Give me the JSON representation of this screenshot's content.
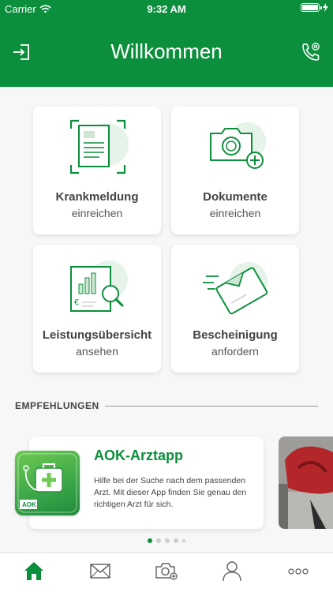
{
  "status_bar": {
    "carrier": "Carrier",
    "time": "9:32 AM"
  },
  "header": {
    "title": "Willkommen",
    "login_icon": "login-icon",
    "call_icon": "phone-email-icon"
  },
  "cards": [
    {
      "line1": "Krankmeldung",
      "line2": "einreichen",
      "icon": "document-scan-icon"
    },
    {
      "line1": "Dokumente",
      "line2": "einreichen",
      "icon": "camera-add-icon"
    },
    {
      "line1": "Leistungsübersicht",
      "line2": "ansehen",
      "icon": "report-search-icon"
    },
    {
      "line1": "Bescheinigung",
      "line2": "anfordern",
      "icon": "certificate-request-icon"
    }
  ],
  "recommendations": {
    "label": "EMPFEHLUNGEN",
    "items": [
      {
        "title": "AOK-Arztapp",
        "description": "Hilfe bei der Suche nach dem passenden Arzt. Mit dieser App finden Sie genau den richtigen Arzt für sich.",
        "icon_badge": "AOK"
      }
    ]
  },
  "tabs": [
    {
      "name": "home-icon",
      "active": true
    },
    {
      "name": "mail-icon",
      "active": false
    },
    {
      "name": "camera-icon",
      "active": false
    },
    {
      "name": "profile-icon",
      "active": false
    },
    {
      "name": "more-icon",
      "active": false
    }
  ],
  "colors": {
    "brand_green": "#0c8f3d",
    "light_green": "#e5f3e8"
  }
}
